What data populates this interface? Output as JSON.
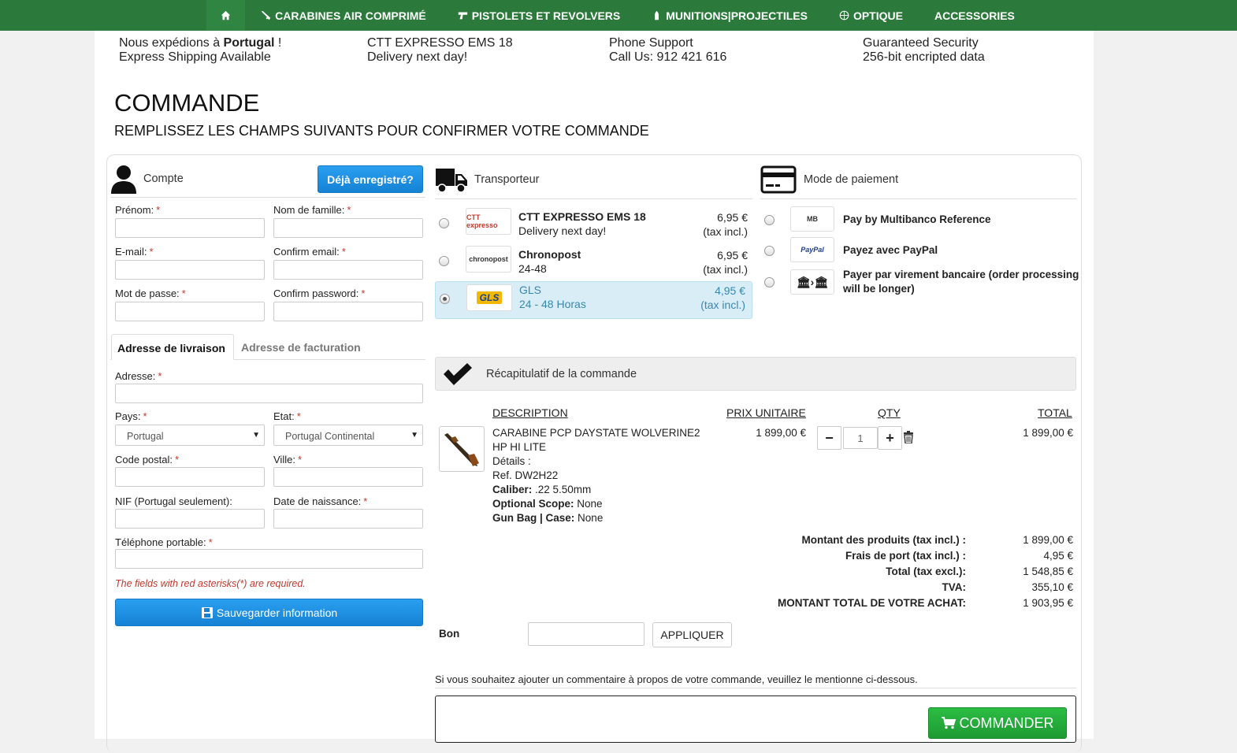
{
  "nav": {
    "items": [
      {
        "label": "CARABINES AIR COMPRIMÉ",
        "icon": "rifle-icon"
      },
      {
        "label": "PISTOLETS ET REVOLVERS",
        "icon": "pistol-icon"
      },
      {
        "label": "MUNITIONS|PROJECTILES",
        "icon": "ammo-icon"
      },
      {
        "label": "OPTIQUE",
        "icon": "crosshair-icon"
      },
      {
        "label": "ACCESSORIES",
        "icon": ""
      }
    ]
  },
  "info": [
    {
      "line1_pre": "Nous expédions à ",
      "line1_bold": "Portugal",
      "line1_post": " !",
      "line2": "Express Shipping Available"
    },
    {
      "line1": "CTT EXPRESSO EMS 18",
      "line2": "Delivery next day!"
    },
    {
      "line1": "Phone Support",
      "line2": "Call Us: 912 421 616"
    },
    {
      "line1": "Guaranteed Security",
      "line2": "256-bit encripted data"
    }
  ],
  "page": {
    "title": "COMMANDE",
    "subtitle": "REMPLISSEZ LES CHAMPS SUIVANTS POUR CONFIRMER VOTRE COMMANDE"
  },
  "account": {
    "heading": "Compte",
    "registered_button": "Déjà enregistré?",
    "fields": {
      "first_name": "Prénom:",
      "last_name": "Nom de famille:",
      "email": "E-mail:",
      "confirm_email": "Confirm email:",
      "password": "Mot de passe:",
      "confirm_password": "Confirm password:"
    },
    "required_mark": "*"
  },
  "address": {
    "tabs": [
      "Adresse de livraison",
      "Adresse de facturation"
    ],
    "address_label": "Adresse:",
    "country_label": "Pays:",
    "country_value": "Portugal",
    "state_label": "Etat:",
    "state_value": "Portugal Continental",
    "postal_label": "Code postal:",
    "city_label": "Ville:",
    "nif_label": "NIF (Portugal seulement):",
    "birth_label": "Date de naissance:",
    "phone_label": "Téléphone portable:",
    "required_note": "The fields with red asterisks(*) are required.",
    "save_button": "Sauvegarder information"
  },
  "shipping": {
    "heading": "Transporteur",
    "carriers": [
      {
        "logo": "CTT expresso",
        "name": "CTT EXPRESSO EMS 18",
        "desc": "Delivery next day!",
        "price": "6,95 €",
        "tax": "(tax incl.)",
        "selected": false
      },
      {
        "logo": "chronopost",
        "name": "Chronopost",
        "desc": "24-48",
        "price": "6,95 €",
        "tax": "(tax incl.)",
        "selected": false
      },
      {
        "logo": "GLS",
        "name": "GLS",
        "desc": "24 - 48 Horas",
        "price": "4,95 €",
        "tax": "(tax incl.)",
        "selected": true
      }
    ]
  },
  "payment": {
    "heading": "Mode de paiement",
    "methods": [
      {
        "logo": "MB",
        "name": "Pay by Multibanco Reference"
      },
      {
        "logo": "PayPal",
        "name": "Payez avec PayPal"
      },
      {
        "logo": "bank-transfer",
        "name": "Payer par virement bancaire (order processing will be longer)"
      }
    ]
  },
  "summary": {
    "heading": "Récapitulatif de la commande",
    "columns": {
      "description": "DESCRIPTION",
      "unit_price": "PRIX UNITAIRE",
      "qty": "QTY",
      "total": "TOTAL"
    },
    "product": {
      "name": "CARABINE PCP DAYSTATE WOLVERINE2 HP HI LITE",
      "details": "Détails :",
      "ref": "Ref. DW2H22",
      "caliber_label": "Caliber:",
      "caliber_value": " .22 5.50mm",
      "scope_label": "Optional Scope:",
      "scope_value": " None",
      "bag_label": "Gun Bag | Case:",
      "bag_value": " None",
      "unit_price": "1 899,00 €",
      "qty": "1",
      "total": "1 899,00 €"
    },
    "totals": [
      {
        "label": "Montant des produits  (tax incl.) :",
        "value": "1 899,00 €"
      },
      {
        "label": "Frais de port  (tax incl.) :",
        "value": "4,95 €"
      },
      {
        "label": "Total  (tax excl.):",
        "value": "1 548,85 €"
      },
      {
        "label": "TVA:",
        "value": "355,10 €"
      },
      {
        "label": "MONTANT TOTAL DE VOTRE ACHAT:",
        "value": "1 903,95 €"
      }
    ],
    "voucher_label": "Bon",
    "voucher_button": "APPLIQUER",
    "comment_prompt": "Si vous souhaitez ajouter un commentaire à propos de votre commande, veuillez le mentionne ci-dessous.",
    "order_button": "COMMANDER"
  },
  "colors": {
    "nav_green": "#2c7a3b",
    "button_blue": "#1a8ee0",
    "order_green": "#22a33a",
    "selected_carrier": "#d9edf7"
  }
}
